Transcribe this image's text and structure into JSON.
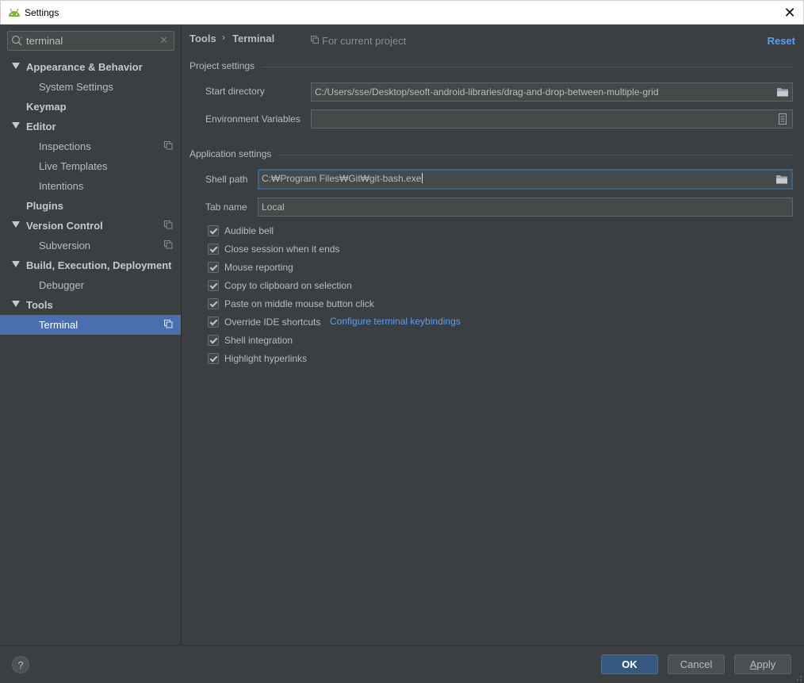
{
  "window": {
    "title": "Settings",
    "close_symbol": "✕",
    "app_icon": "android-icon"
  },
  "search": {
    "value": "terminal",
    "clear_symbol": "✕"
  },
  "tree": [
    {
      "label": "Appearance & Behavior",
      "level": 0,
      "bold": true,
      "expanded": true
    },
    {
      "label": "System Settings",
      "level": 1
    },
    {
      "label": "Keymap",
      "level": 0,
      "bold": true
    },
    {
      "label": "Editor",
      "level": 0,
      "bold": true,
      "expanded": true
    },
    {
      "label": "Inspections",
      "level": 1,
      "project": true
    },
    {
      "label": "Live Templates",
      "level": 1
    },
    {
      "label": "Intentions",
      "level": 1
    },
    {
      "label": "Plugins",
      "level": 0,
      "bold": true
    },
    {
      "label": "Version Control",
      "level": 0,
      "bold": true,
      "expanded": true,
      "project": true
    },
    {
      "label": "Subversion",
      "level": 1,
      "project": true
    },
    {
      "label": "Build, Execution, Deployment",
      "level": 0,
      "bold": true,
      "expanded": true
    },
    {
      "label": "Debugger",
      "level": 1
    },
    {
      "label": "Tools",
      "level": 0,
      "bold": true,
      "expanded": true
    },
    {
      "label": "Terminal",
      "level": 1,
      "project": true,
      "selected": true
    }
  ],
  "breadcrumb": {
    "parent": "Tools",
    "separator": "›",
    "current": "Terminal"
  },
  "for_current_project": "For current project",
  "reset": "Reset",
  "project_settings": {
    "title": "Project settings",
    "start_directory_label": "Start directory",
    "start_directory_value": "C:/Users/sse/Desktop/seoft-android-libraries/drag-and-drop-between-multiple-grid",
    "env_vars_label": "Environment Variables",
    "env_vars_value": ""
  },
  "app_settings": {
    "title": "Application settings",
    "shell_path_label": "Shell path",
    "shell_path_value": "C:₩Program Files₩Git₩git-bash.exe",
    "tab_name_label": "Tab name",
    "tab_name_value": "Local",
    "checkboxes": [
      {
        "label": "Audible bell",
        "checked": true
      },
      {
        "label": "Close session when it ends",
        "checked": true
      },
      {
        "label": "Mouse reporting",
        "checked": true
      },
      {
        "label": "Copy to clipboard on selection",
        "checked": true
      },
      {
        "label": "Paste on middle mouse button click",
        "checked": true
      },
      {
        "label": "Override IDE shortcuts",
        "checked": true
      },
      {
        "label": "Shell integration",
        "checked": true
      },
      {
        "label": "Highlight hyperlinks",
        "checked": true
      }
    ],
    "keybindings_link": "Configure terminal keybindings"
  },
  "footer": {
    "help_symbol": "?",
    "ok": "OK",
    "cancel": "Cancel",
    "apply_mnemonic": "A",
    "apply_rest": "pply"
  },
  "colors": {
    "accent": "#4b6eaf",
    "link": "#589df6",
    "background": "#3c3f41",
    "ok_button": "#365880"
  }
}
